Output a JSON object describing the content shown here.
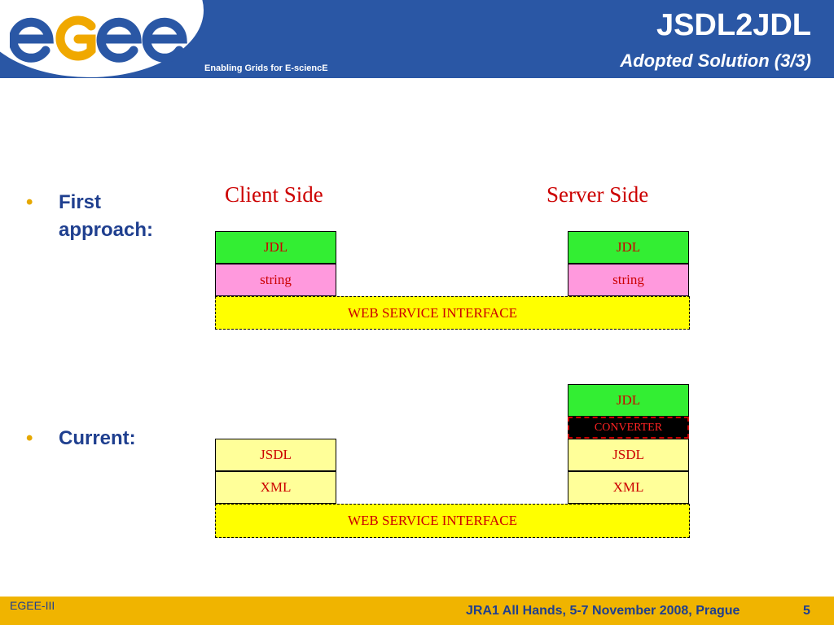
{
  "header": {
    "logo_text": "egee",
    "tagline": "Enabling Grids for E-sciencE",
    "title": "JSDL2JDL",
    "subtitle": "Adopted Solution  (3/3)"
  },
  "bullets": [
    {
      "label": "First approach:"
    },
    {
      "label": "Current:"
    }
  ],
  "diagram": {
    "client_label": "Client Side",
    "server_label": "Server Side",
    "first": {
      "client": [
        "JDL",
        "string"
      ],
      "server": [
        "JDL",
        "string"
      ],
      "interface": "WEB SERVICE INTERFACE"
    },
    "current": {
      "client": [
        "JSDL",
        "XML"
      ],
      "server": [
        "JDL",
        "CONVERTER",
        "JSDL",
        "XML"
      ],
      "interface": "WEB SERVICE INTERFACE"
    }
  },
  "footer": {
    "left": "EGEE-III",
    "middle": "JRA1 All Hands, 5-7 November 2008, Prague",
    "page": "5"
  },
  "colors": {
    "header_blue": "#2a57a5",
    "footer_gold": "#f0b400",
    "label_red": "#cc0000"
  }
}
